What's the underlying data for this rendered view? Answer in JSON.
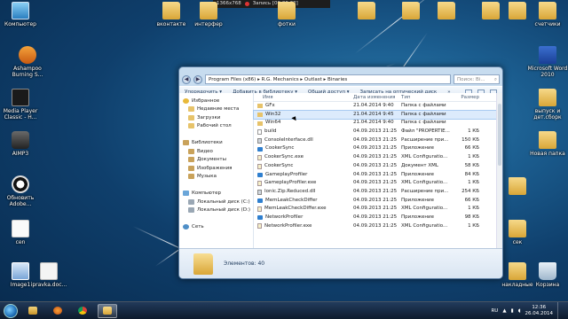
{
  "recorder": {
    "resolution": "1366x768",
    "status": "Запись [00:00:22]"
  },
  "desktop_icons": [
    {
      "label": "Компьютер",
      "type": "pc"
    },
    {
      "label": "Ashampoo Burning S...",
      "type": "app"
    },
    {
      "label": "Media Player Classic - H...",
      "type": "mpc"
    },
    {
      "label": "AIMP3",
      "type": "aimp"
    },
    {
      "label": "Обновить Adobe...",
      "type": "safe"
    },
    {
      "label": "cen",
      "type": "blank"
    },
    {
      "label": "Image1",
      "type": "img"
    },
    {
      "label": "ipravka.doc...",
      "type": "doc"
    },
    {
      "label": "вконтакте",
      "type": "folder"
    },
    {
      "label": "интерфер",
      "type": "folder"
    },
    {
      "label": "фотки",
      "type": "folder"
    },
    {
      "label": "",
      "type": "folder"
    },
    {
      "label": "",
      "type": "folder"
    },
    {
      "label": "",
      "type": "folder"
    },
    {
      "label": "",
      "type": "folder"
    },
    {
      "label": "",
      "type": "folder"
    },
    {
      "label": "счетчики",
      "type": "folder"
    },
    {
      "label": "Microsoft Word 2010",
      "type": "word"
    },
    {
      "label": "выпуск и дет.сборк",
      "type": "folder"
    },
    {
      "label": "Новая папка",
      "type": "folder"
    },
    {
      "label": "",
      "type": "folder"
    },
    {
      "label": "сек",
      "type": "folder"
    },
    {
      "label": "накладные",
      "type": "folder"
    },
    {
      "label": "Корзина",
      "type": "trash"
    }
  ],
  "explorer": {
    "address": "Program Files (x86) ▸ R.G. Mechanics ▸ Outlast ▸ Binaries",
    "search_placeholder": "Поиск: Bi...",
    "toolbar": {
      "organize": "Упорядочить ▾",
      "add_library": "Добавить в библиотеку ▾",
      "share": "Общий доступ ▾",
      "burn": "Записать на оптический диск",
      "more": "»"
    },
    "nav": [
      {
        "label": "Избранное",
        "icon": "star",
        "indent": 0
      },
      {
        "label": "Недавние места",
        "icon": "fold",
        "indent": 1
      },
      {
        "label": "Загрузки",
        "icon": "fold",
        "indent": 1
      },
      {
        "label": "Рабочий стол",
        "icon": "fold",
        "indent": 1
      },
      {
        "label": "",
        "icon": "",
        "indent": 0
      },
      {
        "label": "Библиотеки",
        "icon": "lib",
        "indent": 0
      },
      {
        "label": "Видео",
        "icon": "lib",
        "indent": 1
      },
      {
        "label": "Документы",
        "icon": "lib",
        "indent": 1
      },
      {
        "label": "Изображения",
        "icon": "lib",
        "indent": 1
      },
      {
        "label": "Музыка",
        "icon": "lib",
        "indent": 1
      },
      {
        "label": "",
        "icon": "",
        "indent": 0
      },
      {
        "label": "Компьютер",
        "icon": "pc",
        "indent": 0
      },
      {
        "label": "Локальный диск (C:)",
        "icon": "disk",
        "indent": 1
      },
      {
        "label": "Локальный диск (D:)",
        "icon": "disk",
        "indent": 1
      },
      {
        "label": "",
        "icon": "",
        "indent": 0
      },
      {
        "label": "Сеть",
        "icon": "net",
        "indent": 0
      }
    ],
    "columns": {
      "name": "Имя",
      "date": "Дата изменения",
      "type": "Тип",
      "size": "Размер"
    },
    "files": [
      {
        "name": "GFx",
        "date": "21.04.2014 9:40",
        "type": "Папка с файлами",
        "size": "",
        "icon": "folder",
        "selected": false
      },
      {
        "name": "Win32",
        "date": "21.04.2014 9:45",
        "type": "Папка с файлами",
        "size": "",
        "icon": "folder",
        "selected": true
      },
      {
        "name": "Win64",
        "date": "21.04.2014 9:40",
        "type": "Папка с файлами",
        "size": "",
        "icon": "folder",
        "selected": false
      },
      {
        "name": "build",
        "date": "04.09.2013 21:25",
        "type": "Файл \"PROPERTIE...",
        "size": "1 КБ",
        "icon": "file",
        "selected": false
      },
      {
        "name": "ConsoleInterface.dll",
        "date": "04.09.2013 21:25",
        "type": "Расширение при...",
        "size": "150 КБ",
        "icon": "dll",
        "selected": false
      },
      {
        "name": "CookerSync",
        "date": "04.09.2013 21:25",
        "type": "Приложение",
        "size": "66 КБ",
        "icon": "exe",
        "selected": false
      },
      {
        "name": "CookerSync.exe",
        "date": "04.09.2013 21:25",
        "type": "XML Configuratio...",
        "size": "1 КБ",
        "icon": "xml",
        "selected": false
      },
      {
        "name": "CookerSync",
        "date": "04.09.2013 21:25",
        "type": "Документ XML",
        "size": "58 КБ",
        "icon": "xml",
        "selected": false
      },
      {
        "name": "GameplayProfiler",
        "date": "04.09.2013 21:25",
        "type": "Приложение",
        "size": "84 КБ",
        "icon": "exe",
        "selected": false
      },
      {
        "name": "GameplayProfiler.exe",
        "date": "04.09.2013 21:25",
        "type": "XML Configuratio...",
        "size": "1 КБ",
        "icon": "xml",
        "selected": false
      },
      {
        "name": "Ionic.Zip.Reduced.dll",
        "date": "04.09.2013 21:25",
        "type": "Расширение при...",
        "size": "254 КБ",
        "icon": "dll",
        "selected": false
      },
      {
        "name": "MemLeakCheckDiffer",
        "date": "04.09.2013 21:25",
        "type": "Приложение",
        "size": "66 КБ",
        "icon": "exe",
        "selected": false
      },
      {
        "name": "MemLeakCheckDiffer.exe",
        "date": "04.09.2013 21:25",
        "type": "XML Configuratio...",
        "size": "1 КБ",
        "icon": "xml",
        "selected": false
      },
      {
        "name": "NetworkProfiler",
        "date": "04.09.2013 21:25",
        "type": "Приложение",
        "size": "98 КБ",
        "icon": "exe",
        "selected": false
      },
      {
        "name": "NetworkProfiler.exe",
        "date": "04.09.2013 21:25",
        "type": "XML Configuratio...",
        "size": "1 КБ",
        "icon": "xml",
        "selected": false
      }
    ],
    "details": "Элементов: 40"
  },
  "taskbar": {
    "apps": [
      "explorer",
      "media",
      "chrome",
      "folder-active"
    ],
    "lang": "RU",
    "time": "12:36",
    "date": "26.04.2014"
  }
}
